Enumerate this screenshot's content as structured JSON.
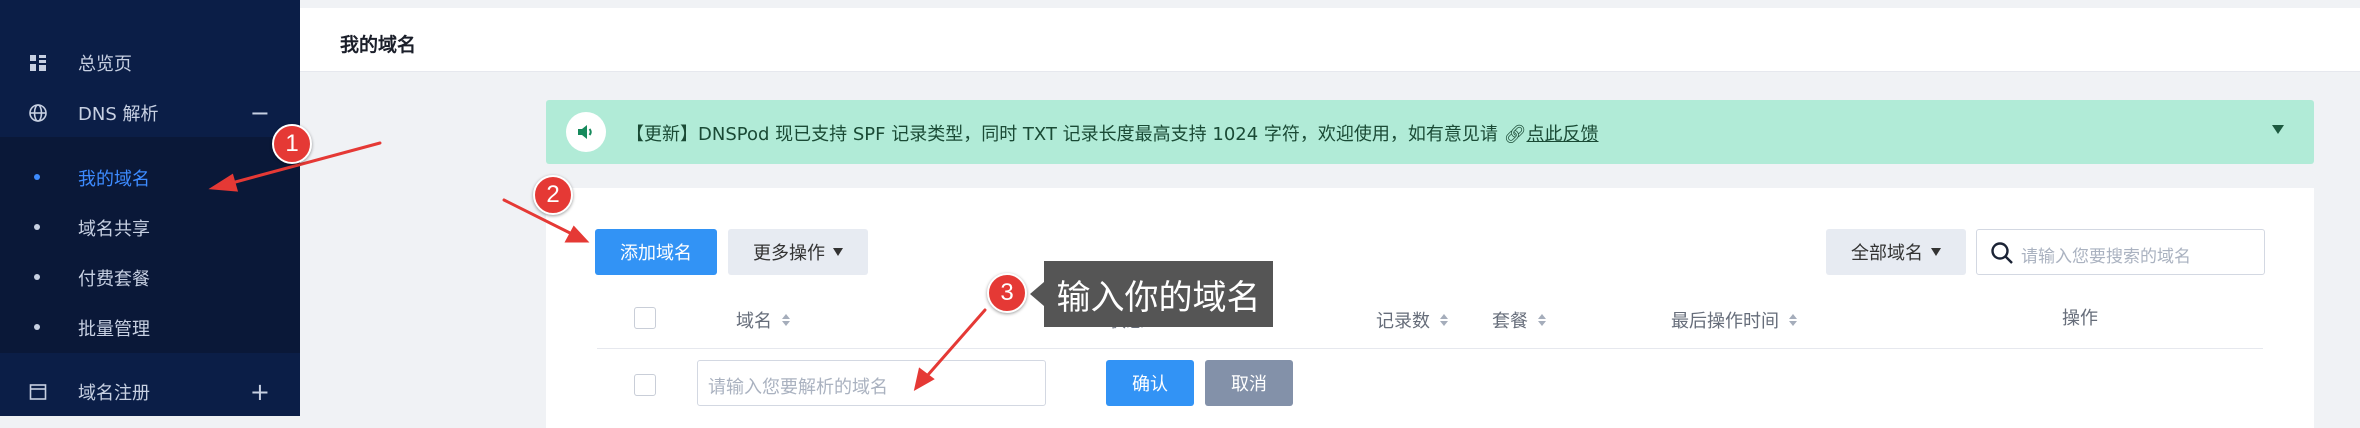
{
  "sidebar": {
    "items": [
      {
        "label": "总览页",
        "icon": "dashboard-icon"
      },
      {
        "label": "DNS 解析",
        "icon": "globe-icon",
        "toggle": "−"
      },
      {
        "label": "域名注册",
        "icon": "window-icon",
        "toggle": "+"
      }
    ],
    "subitems": [
      {
        "label": "我的域名",
        "active": true
      },
      {
        "label": "域名共享"
      },
      {
        "label": "付费套餐"
      },
      {
        "label": "批量管理"
      }
    ]
  },
  "header": {
    "title": "我的域名"
  },
  "notice": {
    "icon": "speaker-icon",
    "text": "【更新】DNSPod 现已支持 SPF 记录类型，同时 TXT 记录长度最高支持 1024 字符，欢迎使用，如有意见请 ",
    "link_icon": "link-icon",
    "link": "点此反馈"
  },
  "toolbar": {
    "add_label": "添加域名",
    "more_label": "更多操作",
    "filter_label": "全部域名",
    "search_placeholder": "请输入您要搜索的域名"
  },
  "table": {
    "columns": [
      "域名",
      "状态",
      "记录数",
      "套餐",
      "最后操作时间",
      "操作"
    ]
  },
  "new_row": {
    "placeholder": "请输入您要解析的域名",
    "confirm_label": "确认",
    "cancel_label": "取消"
  },
  "tooltip": {
    "text": "输入你的域名"
  },
  "annotations": {
    "badges": [
      "1",
      "2",
      "3"
    ],
    "color": "#e53935"
  },
  "colors": {
    "sidebar": "#0b1e47",
    "primary": "#3293f5",
    "notice_bg": "#b1ebd7",
    "active_nav": "#3d8bff"
  }
}
